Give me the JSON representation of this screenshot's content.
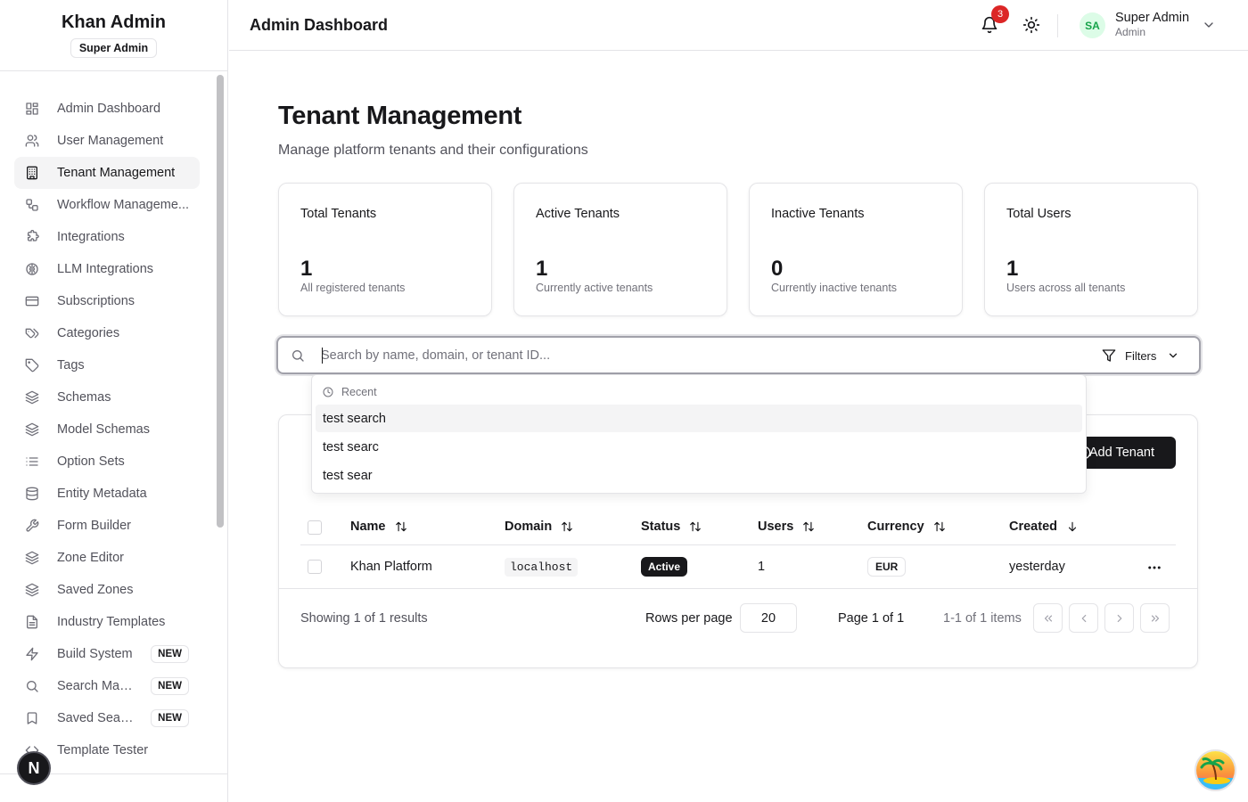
{
  "sidebar": {
    "brand_title": "Khan Admin",
    "brand_badge": "Super Admin",
    "items": [
      {
        "label": "Admin Dashboard",
        "icon": "dashboard-icon"
      },
      {
        "label": "User Management",
        "icon": "users-icon"
      },
      {
        "label": "Tenant Management",
        "icon": "building-icon",
        "active": true
      },
      {
        "label": "Workflow Manageme...",
        "icon": "workflow-icon"
      },
      {
        "label": "Integrations",
        "icon": "puzzle-icon"
      },
      {
        "label": "LLM Integrations",
        "icon": "brain-icon"
      },
      {
        "label": "Subscriptions",
        "icon": "credit-card-icon"
      },
      {
        "label": "Categories",
        "icon": "tags-icon"
      },
      {
        "label": "Tags",
        "icon": "tag-icon"
      },
      {
        "label": "Schemas",
        "icon": "layers-icon"
      },
      {
        "label": "Model Schemas",
        "icon": "layers-icon"
      },
      {
        "label": "Option Sets",
        "icon": "list-icon"
      },
      {
        "label": "Entity Metadata",
        "icon": "database-icon"
      },
      {
        "label": "Form Builder",
        "icon": "wrench-icon"
      },
      {
        "label": "Zone Editor",
        "icon": "layers-icon"
      },
      {
        "label": "Saved Zones",
        "icon": "layers-icon"
      },
      {
        "label": "Industry Templates",
        "icon": "file-icon"
      },
      {
        "label": "Build System",
        "icon": "zap-icon",
        "badge": "NEW"
      },
      {
        "label": "Search Man...",
        "icon": "search-icon",
        "badge": "NEW"
      },
      {
        "label": "Saved Searc...",
        "icon": "bookmark-icon",
        "badge": "NEW"
      },
      {
        "label": "Template Tester",
        "icon": "code-icon"
      }
    ],
    "dev_badge": "N"
  },
  "header": {
    "title": "Admin Dashboard",
    "notification_count": "3",
    "user_initials": "SA",
    "user_name": "Super Admin",
    "user_role": "Admin"
  },
  "main": {
    "title": "Tenant Management",
    "subtitle": "Manage platform tenants and their configurations",
    "stats": [
      {
        "label": "Total Tenants",
        "value": "1",
        "desc": "All registered tenants"
      },
      {
        "label": "Active Tenants",
        "value": "1",
        "desc": "Currently active tenants"
      },
      {
        "label": "Inactive Tenants",
        "value": "0",
        "desc": "Currently inactive tenants"
      },
      {
        "label": "Total Users",
        "value": "1",
        "desc": "Users across all tenants"
      }
    ],
    "search": {
      "placeholder": "Search by name, domain, or tenant ID...",
      "value": "",
      "filters_label": "Filters"
    },
    "recent": {
      "heading": "Recent",
      "items": [
        "test search",
        "test searc",
        "test sear"
      ]
    },
    "add_button": "Add Tenant",
    "table": {
      "columns": [
        "Name",
        "Domain",
        "Status",
        "Users",
        "Currency",
        "Created"
      ],
      "rows": [
        {
          "name": "Khan Platform",
          "domain": "localhost",
          "status": "Active",
          "users": "1",
          "currency": "EUR",
          "created": "yesterday"
        }
      ]
    },
    "footer": {
      "showing": "Showing 1 of 1 results",
      "rows_per_page_label": "Rows per page",
      "rows_per_page": "20",
      "page": "Page 1 of 1",
      "items": "1-1 of 1 items"
    }
  },
  "colors": {
    "primary": "#18181b",
    "notification": "#dc2626",
    "avatar_bg": "#dcfce7",
    "avatar_fg": "#16a34a",
    "border": "#e4e4e7"
  }
}
